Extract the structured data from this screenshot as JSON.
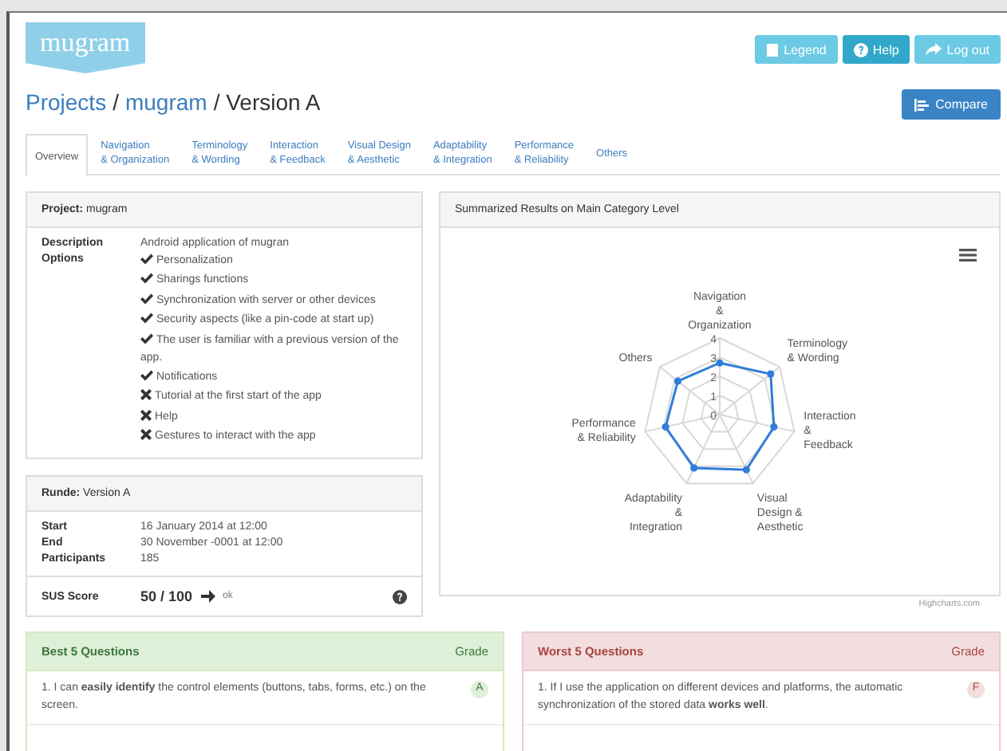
{
  "header": {
    "logo": "mugram",
    "buttons": [
      {
        "label": "Legend",
        "kind": "legend"
      },
      {
        "label": "Help",
        "kind": "help"
      },
      {
        "label": "Log out",
        "kind": "logout"
      }
    ]
  },
  "breadcrumb": [
    {
      "text": "Projects",
      "link": true
    },
    {
      "text": "/",
      "link": false
    },
    {
      "text": "mugram",
      "link": true
    },
    {
      "text": "/ Version A",
      "link": false
    }
  ],
  "compare_button": "Compare",
  "tabs": [
    {
      "label": "Overview",
      "selected": true
    },
    {
      "label": "Navigation\n& Organization",
      "selected": false
    },
    {
      "label": "Terminology\n& Wording",
      "selected": false
    },
    {
      "label": "Interaction\n& Feedback",
      "selected": false
    },
    {
      "label": "Visual Design\n& Aesthetic",
      "selected": false
    },
    {
      "label": "Adaptability\n& Integration",
      "selected": false
    },
    {
      "label": "Performance\n& Reliability",
      "selected": false
    },
    {
      "label": "Others",
      "selected": false
    }
  ],
  "project_panel": {
    "title": "**Project:** mugram",
    "description_label": "Description",
    "description": "Android application of mugran",
    "options_label": "Options",
    "options": [
      {
        "text": "Personalization",
        "checked": true
      },
      {
        "text": "Sharings functions",
        "checked": true
      },
      {
        "text": "Synchronization with server or other devices",
        "checked": true
      },
      {
        "text": "Security aspects (like a pin-code at start up)",
        "checked": true
      },
      {
        "text": "The user is familiar with a previous version of the app.",
        "checked": true
      },
      {
        "text": "Notifications",
        "checked": true
      },
      {
        "text": "Tutorial at the first start of the app",
        "checked": false
      },
      {
        "text": "Help",
        "checked": false
      },
      {
        "text": "Gestures to interact with the app",
        "checked": false
      }
    ]
  },
  "round_panel": {
    "title": "**Runde:** Version A",
    "rows": [
      {
        "label": "Start",
        "value": "16 January 2014 at 12:00"
      },
      {
        "label": "End",
        "value": "30 November -0001 at 12:00"
      },
      {
        "label": "Participants",
        "value": "185"
      }
    ],
    "sus_label": "SUS Score",
    "sus_score": "50 / 100",
    "sus_rating": "ok"
  },
  "chart_panel": {
    "title": "Summarized Results on Main Category Level",
    "credit": "Highcharts.com",
    "radar": {
      "axis_labels": [
        "Navigation\n&\nOrganization",
        "Others",
        "Terminology\n& Wording",
        "Performance\n& Reliability",
        "Interaction\n&\nFeedback",
        "Adaptability\n&\nIntegration",
        "Visual\nDesign &\nAesthetic"
      ],
      "tick_labels": [
        "4",
        "3",
        "2",
        "1",
        "0"
      ]
    }
  },
  "question_panels": [
    {
      "kind": "best",
      "title": "Best 5 Questions",
      "grade_label": "Grade",
      "questions": [
        {
          "text": "1. I can **easily identify** the control elements (buttons, tabs, forms, etc.) on the screen.",
          "grade": "A"
        }
      ]
    },
    {
      "kind": "worst",
      "title": "Worst 5 Questions",
      "grade_label": "Grade",
      "questions": [
        {
          "text": "1. If I use the application on different devices and platforms, the automatic synchronization of the stored data **works well**.",
          "grade": "F"
        }
      ]
    }
  ]
}
